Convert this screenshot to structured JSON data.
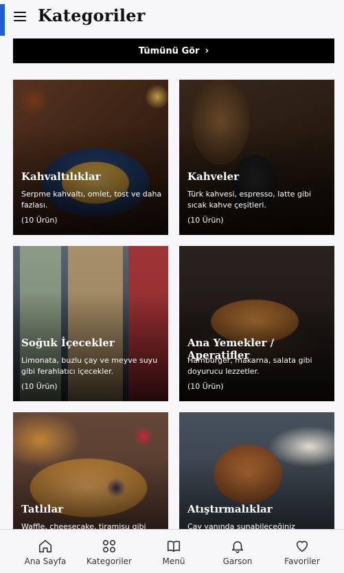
{
  "header": {
    "title": "Kategoriler",
    "menu_icon": "hamburger-icon",
    "accent": "#1e5fd6"
  },
  "all_button": {
    "label": "Tümünü Gör",
    "icon": "chevron-right-icon"
  },
  "categories": [
    {
      "title": "Kahvaltılıklar",
      "desc": "Serpme kahvaltı, omlet, tost ve daha fazlası.",
      "count": "(10 Ürün)"
    },
    {
      "title": "Kahveler",
      "desc": "Türk kahvesi, espresso, latte gibi sıcak kahve çeşitleri.",
      "count": "(10 Ürün)"
    },
    {
      "title": "Soğuk İçecekler",
      "desc": "Limonata, buzlu çay ve meyve suyu gibi ferahlatıcı içecekler.",
      "count": "(10 Ürün)"
    },
    {
      "title": "Ana Yemekler / Aperatifler",
      "desc": "Hamburger, makarna, salata gibi doyurucu lezzetler.",
      "count": "(10 Ürün)"
    },
    {
      "title": "Tatlılar",
      "desc": "Waffle, cheesecake, tiramisu gibi",
      "count": ""
    },
    {
      "title": "Atıştırmalıklar",
      "desc": "Çay yanında sunabileceğiniz",
      "count": ""
    }
  ],
  "tabs": [
    {
      "label": "Ana Sayfa",
      "icon": "home-icon"
    },
    {
      "label": "Kategoriler",
      "icon": "grid-icon"
    },
    {
      "label": "Menü",
      "icon": "book-icon"
    },
    {
      "label": "Garson",
      "icon": "bell-icon"
    },
    {
      "label": "Favoriler",
      "icon": "heart-icon"
    }
  ]
}
